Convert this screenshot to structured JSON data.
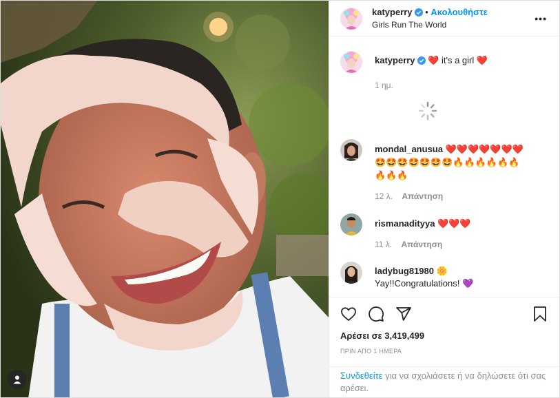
{
  "post": {
    "author": "katyperry",
    "follow_label": "Ακολουθήστε",
    "separator": "•",
    "location": "Girls Run The World",
    "more_label": "•••"
  },
  "caption": {
    "author": "katyperry",
    "text": "it's a girl",
    "time": "1 ημ."
  },
  "comments": [
    {
      "user": "mondal_anusua",
      "line1": "❤️❤️❤️❤️❤️❤️❤️",
      "line2": "🤩🤩🤩🤩🤩🤩🤩🔥🔥🔥🔥🔥🔥",
      "line3": "🔥🔥🔥",
      "time": "12 λ.",
      "reply": "Απάντηση"
    },
    {
      "user": "rismanadityya",
      "text": "❤️❤️❤️",
      "time": "11 λ.",
      "reply": "Απάντηση"
    },
    {
      "user": "ladybug81980",
      "emoji": "🌼",
      "text": "Yay!!Congratulations! 💜"
    }
  ],
  "likes": {
    "label": "Αρέσει σε 3,419,499"
  },
  "posted": "ΠΡΙΝ ΑΠΟ 1 ΗΜΕΡΑ",
  "login": {
    "link": "Συνδεθείτε",
    "text": " για να σχολιάσετε ή να δηλώσετε ότι σας αρέσει."
  },
  "colors": {
    "accent": "#0095f6",
    "heart": "#ed1c24",
    "muted": "#8e8e8e"
  }
}
